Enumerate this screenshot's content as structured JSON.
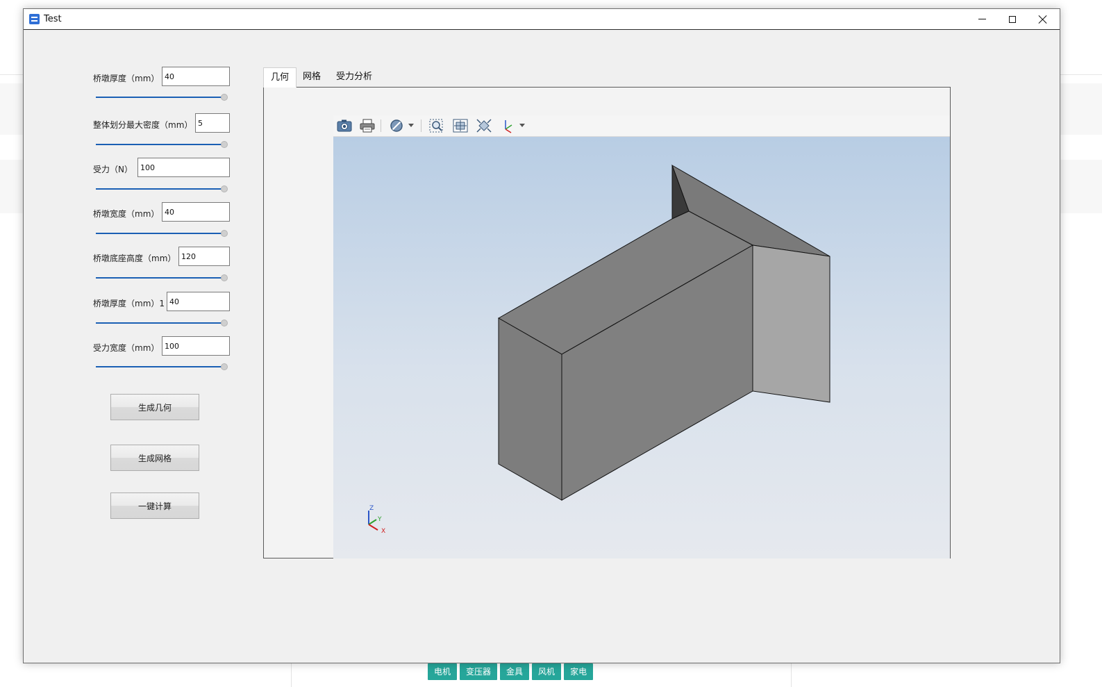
{
  "window": {
    "title": "Test"
  },
  "params": [
    {
      "label": "桥墩厚度（mm）",
      "value": "40"
    },
    {
      "label": "整体划分最大密度（mm）",
      "value": "5"
    },
    {
      "label": "受力（N）",
      "value": "100"
    },
    {
      "label": "桥墩宽度（mm）",
      "value": "40"
    },
    {
      "label": "桥墩底座高度（mm）",
      "value": "120"
    },
    {
      "label": "桥墩厚度（mm）1",
      "value": "40"
    },
    {
      "label": "受力宽度（mm）",
      "value": "100"
    }
  ],
  "slider_levels": [
    1,
    1,
    1,
    1,
    1,
    1,
    1
  ],
  "actions": {
    "generate_geometry": "生成几何",
    "generate_mesh": "生成网格",
    "compute_all": "一键计算"
  },
  "tabs": [
    {
      "label": "几何",
      "active": true
    },
    {
      "label": "网格"
    },
    {
      "label": "受力分析"
    }
  ],
  "toolbar_icons": [
    "camera-icon",
    "print-icon",
    "display-mode-icon",
    "zoom-window-icon",
    "fit-all-icon",
    "fit-selection-icon",
    "axis-view-icon"
  ],
  "axis_triad": {
    "z": "Z",
    "y": "Y",
    "x": "X"
  },
  "bottom_tags": [
    "电机",
    "变压器",
    "金具",
    "风机",
    "家电"
  ],
  "colors": {
    "accent": "#1a5fb4",
    "tag": "#26a69a"
  }
}
